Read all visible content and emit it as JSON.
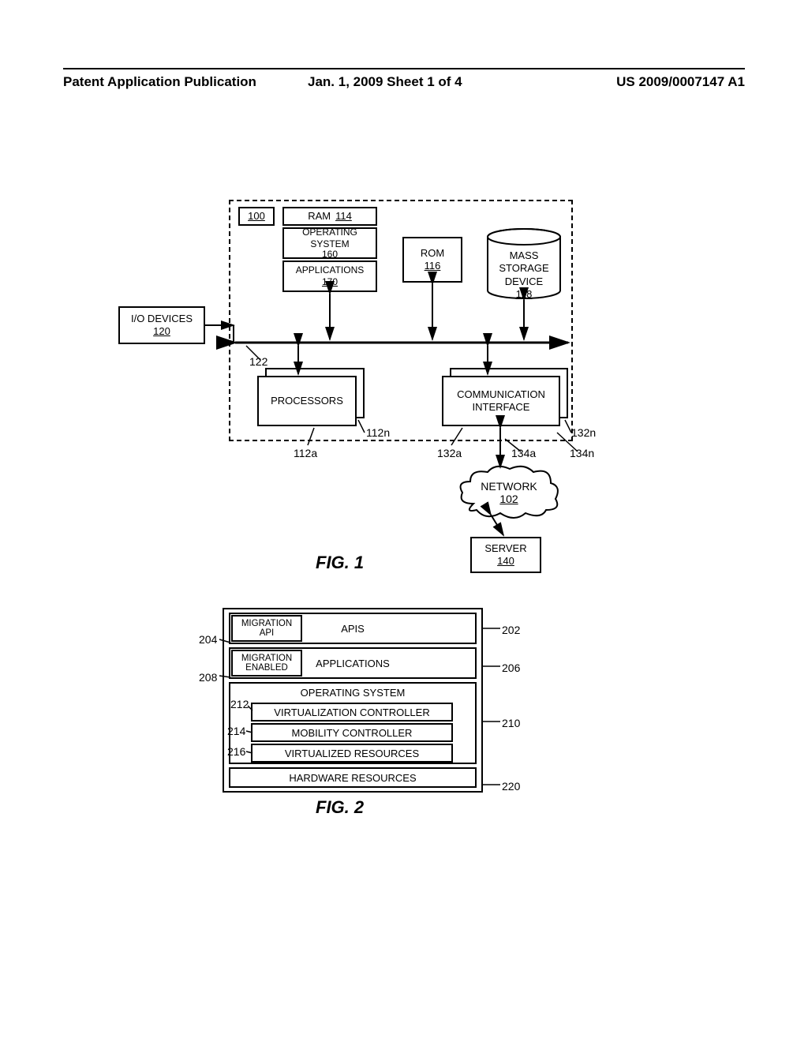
{
  "header": {
    "left": "Patent Application Publication",
    "middle": "Jan. 1, 2009   Sheet 1 of 4",
    "right": "US 2009/0007147 A1"
  },
  "fig1": {
    "caption": "FIG. 1",
    "ref_100": "100",
    "io_devices_label": "I/O DEVICES",
    "io_devices_num": "120",
    "ram_label": "RAM",
    "ram_num": "114",
    "os_label": "OPERATING\nSYSTEM",
    "os_num": "160",
    "apps_label": "APPLICATIONS",
    "apps_num": "170",
    "rom_label": "ROM",
    "rom_num": "116",
    "storage_label": "MASS\nSTORAGE\nDEVICE",
    "storage_num": "118",
    "processors_label": "PROCESSORS",
    "comm_label": "COMMUNICATION\nINTERFACE",
    "ref_122": "122",
    "ref_112a": "112a",
    "ref_112n": "112n",
    "ref_132a": "132a",
    "ref_132n": "132n",
    "ref_134a": "134a",
    "ref_134n": "134n",
    "network_label": "NETWORK",
    "network_num": "102",
    "server_label": "SERVER",
    "server_num": "140"
  },
  "fig2": {
    "caption": "FIG. 2",
    "apis_label": "APIS",
    "migration_api_label": "MIGRATION\nAPI",
    "applications_label": "APPLICATIONS",
    "migration_enabled_label": "MIGRATION\nENABLED",
    "os_label": "OPERATING SYSTEM",
    "virt_ctrl_label": "VIRTUALIZATION CONTROLLER",
    "mobility_ctrl_label": "MOBILITY CONTROLLER",
    "virt_res_label": "VIRTUALIZED RESOURCES",
    "hw_label": "HARDWARE RESOURCES",
    "ref_202": "202",
    "ref_204": "204",
    "ref_206": "206",
    "ref_208": "208",
    "ref_210": "210",
    "ref_212": "212",
    "ref_214": "214",
    "ref_216": "216",
    "ref_220": "220"
  }
}
